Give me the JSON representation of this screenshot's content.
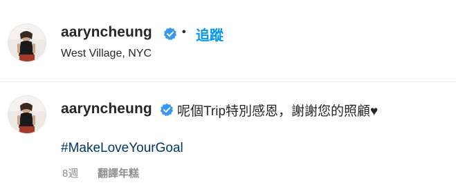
{
  "post_header": {
    "username": "aaryncheung",
    "separator": "•",
    "follow_label": "追蹤",
    "location": "West Village, NYC"
  },
  "caption": {
    "username": "aaryncheung",
    "text": "呢個Trip特別感恩，謝謝您的照顧♥",
    "hashtag": "#MakeLoveYourGoal",
    "time_ago": "8週",
    "translate_label": "翻譯年糕"
  },
  "colors": {
    "accent": "#0095f6",
    "verified_badge": "#3897f0",
    "hashtag": "#00376b",
    "secondary_text": "#8e8e8e",
    "primary_text": "#262626"
  },
  "icons": {
    "verified": "verified-badge-icon"
  }
}
